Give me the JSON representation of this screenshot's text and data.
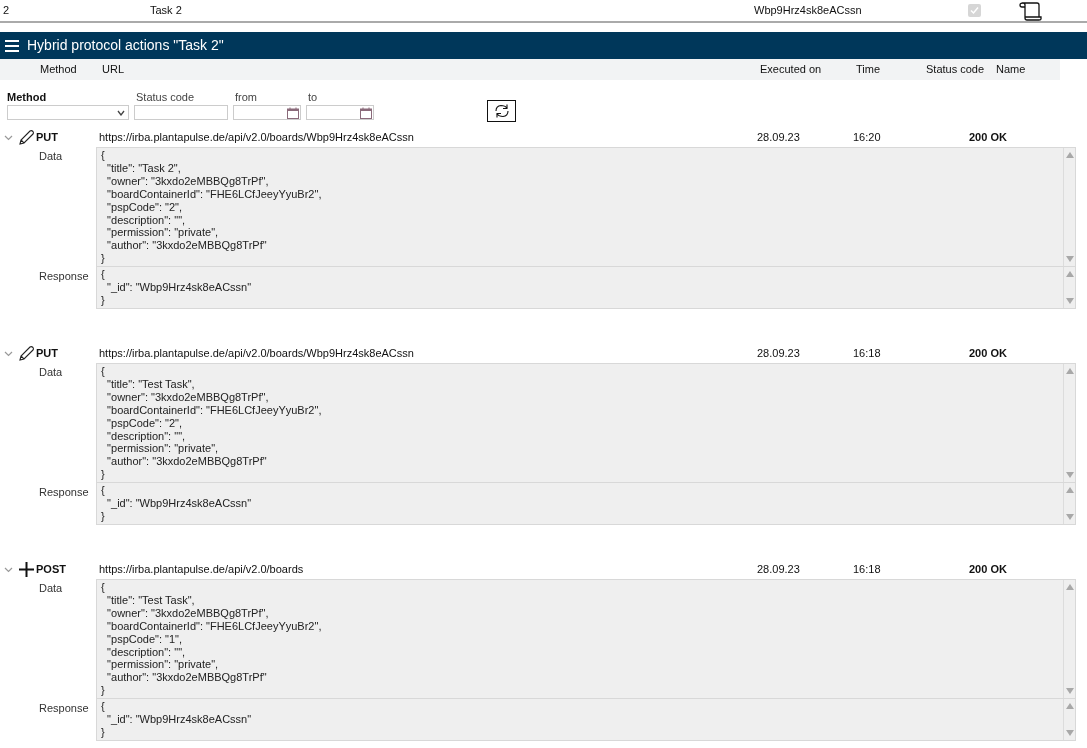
{
  "top_row": {
    "cells": [
      "2",
      "Task 2",
      "Wbp9Hrz4sk8eACssn"
    ],
    "checked": true,
    "disabled": true
  },
  "panel": {
    "title": "Hybrid protocol actions \"Task 2\""
  },
  "columns": [
    "Method",
    "URL",
    "Executed on",
    "Time",
    "Status code",
    "Name"
  ],
  "filters": {
    "method_label": "Method",
    "status_label": "Status code",
    "from_label": "from",
    "to_label": "to"
  },
  "entries": [
    {
      "kind": "edit",
      "expanded": true,
      "method": "PUT",
      "url": "https://irba.plantapulse.de/api/v2.0/boards/Wbp9Hrz4sk8eACssn",
      "date": "28.09.23",
      "time": "16:20",
      "status": "200 OK",
      "data_label": "Data",
      "data": "{\n  \"title\": \"Task 2\",\n  \"owner\": \"3kxdo2eMBBQg8TrPf\",\n  \"boardContainerId\": \"FHE6LCfJeeyYyuBr2\",\n  \"pspCode\": \"2\",\n  \"description\": \"\",\n  \"permission\": \"private\",\n  \"author\": \"3kxdo2eMBBQg8TrPf\"\n}",
      "response_label": "Response",
      "response": "{\n  \"_id\": \"Wbp9Hrz4sk8eACssn\"\n}"
    },
    {
      "kind": "edit",
      "expanded": true,
      "method": "PUT",
      "url": "https://irba.plantapulse.de/api/v2.0/boards/Wbp9Hrz4sk8eACssn",
      "date": "28.09.23",
      "time": "16:18",
      "status": "200 OK",
      "data_label": "Data",
      "data": "{\n  \"title\": \"Test Task\",\n  \"owner\": \"3kxdo2eMBBQg8TrPf\",\n  \"boardContainerId\": \"FHE6LCfJeeyYyuBr2\",\n  \"pspCode\": \"2\",\n  \"description\": \"\",\n  \"permission\": \"private\",\n  \"author\": \"3kxdo2eMBBQg8TrPf\"\n}",
      "response_label": "Response",
      "response": "{\n  \"_id\": \"Wbp9Hrz4sk8eACssn\"\n}"
    },
    {
      "kind": "create",
      "expanded": true,
      "method": "POST",
      "url": "https://irba.plantapulse.de/api/v2.0/boards",
      "date": "28.09.23",
      "time": "16:18",
      "status": "200 OK",
      "data_label": "Data",
      "data": "{\n  \"title\": \"Test Task\",\n  \"owner\": \"3kxdo2eMBBQg8TrPf\",\n  \"boardContainerId\": \"FHE6LCfJeeyYyuBr2\",\n  \"pspCode\": \"1\",\n  \"description\": \"\",\n  \"permission\": \"private\",\n  \"author\": \"3kxdo2eMBBQg8TrPf\"\n}",
      "response_label": "Response",
      "response": "{\n  \"_id\": \"Wbp9Hrz4sk8eACssn\"\n}"
    }
  ]
}
